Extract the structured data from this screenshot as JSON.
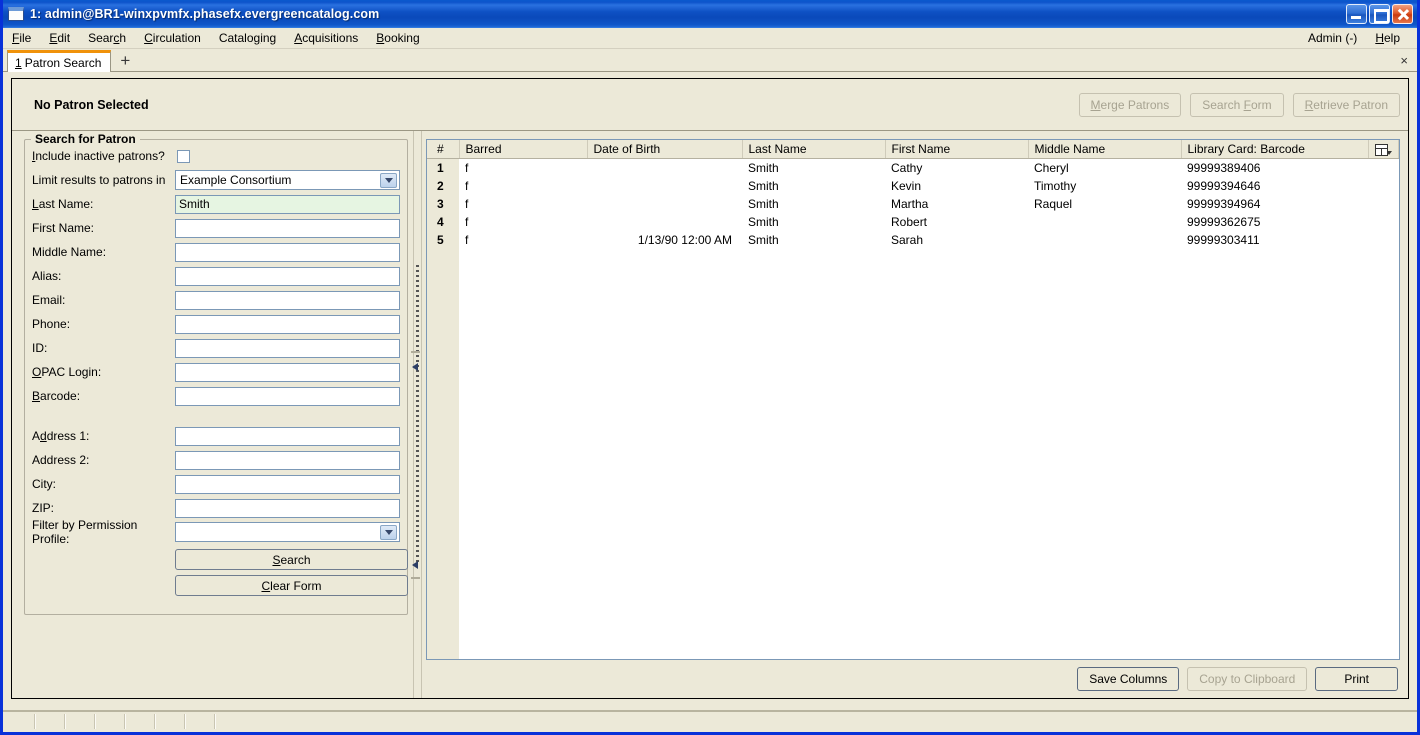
{
  "window": {
    "title": "1: admin@BR1-winxpvmfx.phasefx.evergreencatalog.com",
    "minimize_label": "Minimize",
    "maximize_label": "Maximize",
    "close_label": "Close"
  },
  "menubar": {
    "items": [
      {
        "label": "File",
        "accel": "F"
      },
      {
        "label": "Edit",
        "accel": "E"
      },
      {
        "label": "Search",
        "accel": "c"
      },
      {
        "label": "Circulation",
        "accel": "C"
      },
      {
        "label": "Cataloging",
        "accel": "g"
      },
      {
        "label": "Acquisitions",
        "accel": "A"
      },
      {
        "label": "Booking",
        "accel": "B"
      }
    ],
    "admin_label": "Admin (-)",
    "help_label": "Help"
  },
  "tabs": {
    "active": {
      "number": "1",
      "label": "Patron Search"
    },
    "add_label": "+",
    "close_label": "×"
  },
  "patron_header": {
    "title": "No Patron Selected",
    "buttons": [
      {
        "label": "Merge Patrons",
        "disabled": true
      },
      {
        "label": "Search Form",
        "disabled": true
      },
      {
        "label": "Retrieve Patron",
        "disabled": true
      }
    ]
  },
  "search_form": {
    "legend": "Search for Patron",
    "include_inactive_label": "Include inactive patrons?",
    "include_inactive_checked": false,
    "limit_results_label": "Limit results to patrons in",
    "limit_results_value": "Example Consortium",
    "fields": [
      {
        "label": "Last Name:",
        "value": "Smith",
        "active": true
      },
      {
        "label": "First Name:",
        "value": "",
        "active": false
      },
      {
        "label": "Middle Name:",
        "value": "",
        "active": false
      },
      {
        "label": "Alias:",
        "value": "",
        "active": false
      },
      {
        "label": "Email:",
        "value": "",
        "active": false
      },
      {
        "label": "Phone:",
        "value": "",
        "active": false
      },
      {
        "label": "ID:",
        "value": "",
        "active": false
      },
      {
        "label": "OPAC Login:",
        "value": "",
        "active": false
      },
      {
        "label": "Barcode:",
        "value": "",
        "active": false
      }
    ],
    "address_fields": [
      {
        "label": "Address 1:",
        "value": ""
      },
      {
        "label": "Address 2:",
        "value": ""
      },
      {
        "label": "City:",
        "value": ""
      },
      {
        "label": "ZIP:",
        "value": ""
      }
    ],
    "permission_profile_label": "Filter by Permission Profile:",
    "permission_profile_value": "",
    "search_button": "Search",
    "clear_button": "Clear Form"
  },
  "results": {
    "columns": [
      "#",
      "Barred",
      "Date of Birth",
      "Last Name",
      "First Name",
      "Middle Name",
      "Library Card: Barcode"
    ],
    "column_picker_title": "Column Picker",
    "rows": [
      {
        "num": "1",
        "barred": "f",
        "dob": "",
        "last": "Smith",
        "first": "Cathy",
        "middle": "Cheryl",
        "barcode": "99999389406"
      },
      {
        "num": "2",
        "barred": "f",
        "dob": "",
        "last": "Smith",
        "first": "Kevin",
        "middle": "Timothy",
        "barcode": "99999394646"
      },
      {
        "num": "3",
        "barred": "f",
        "dob": "",
        "last": "Smith",
        "first": "Martha",
        "middle": "Raquel",
        "barcode": "99999394964"
      },
      {
        "num": "4",
        "barred": "f",
        "dob": "",
        "last": "Smith",
        "first": "Robert",
        "middle": "",
        "barcode": "99999362675"
      },
      {
        "num": "5",
        "barred": "f",
        "dob": "1/13/90 12:00 AM",
        "last": "Smith",
        "first": "Sarah",
        "middle": "",
        "barcode": "99999303411"
      }
    ]
  },
  "bottom_bar": {
    "save_columns": "Save Columns",
    "copy_clipboard": "Copy to Clipboard",
    "copy_clipboard_disabled": true,
    "print": "Print"
  },
  "colors": {
    "titlebar_blue": "#0831d9",
    "window_chrome": "#ece9d8",
    "active_field_green": "#e6f5e2",
    "tab_accent_orange": "#f0920a",
    "field_border_blue": "#7b98b6"
  }
}
